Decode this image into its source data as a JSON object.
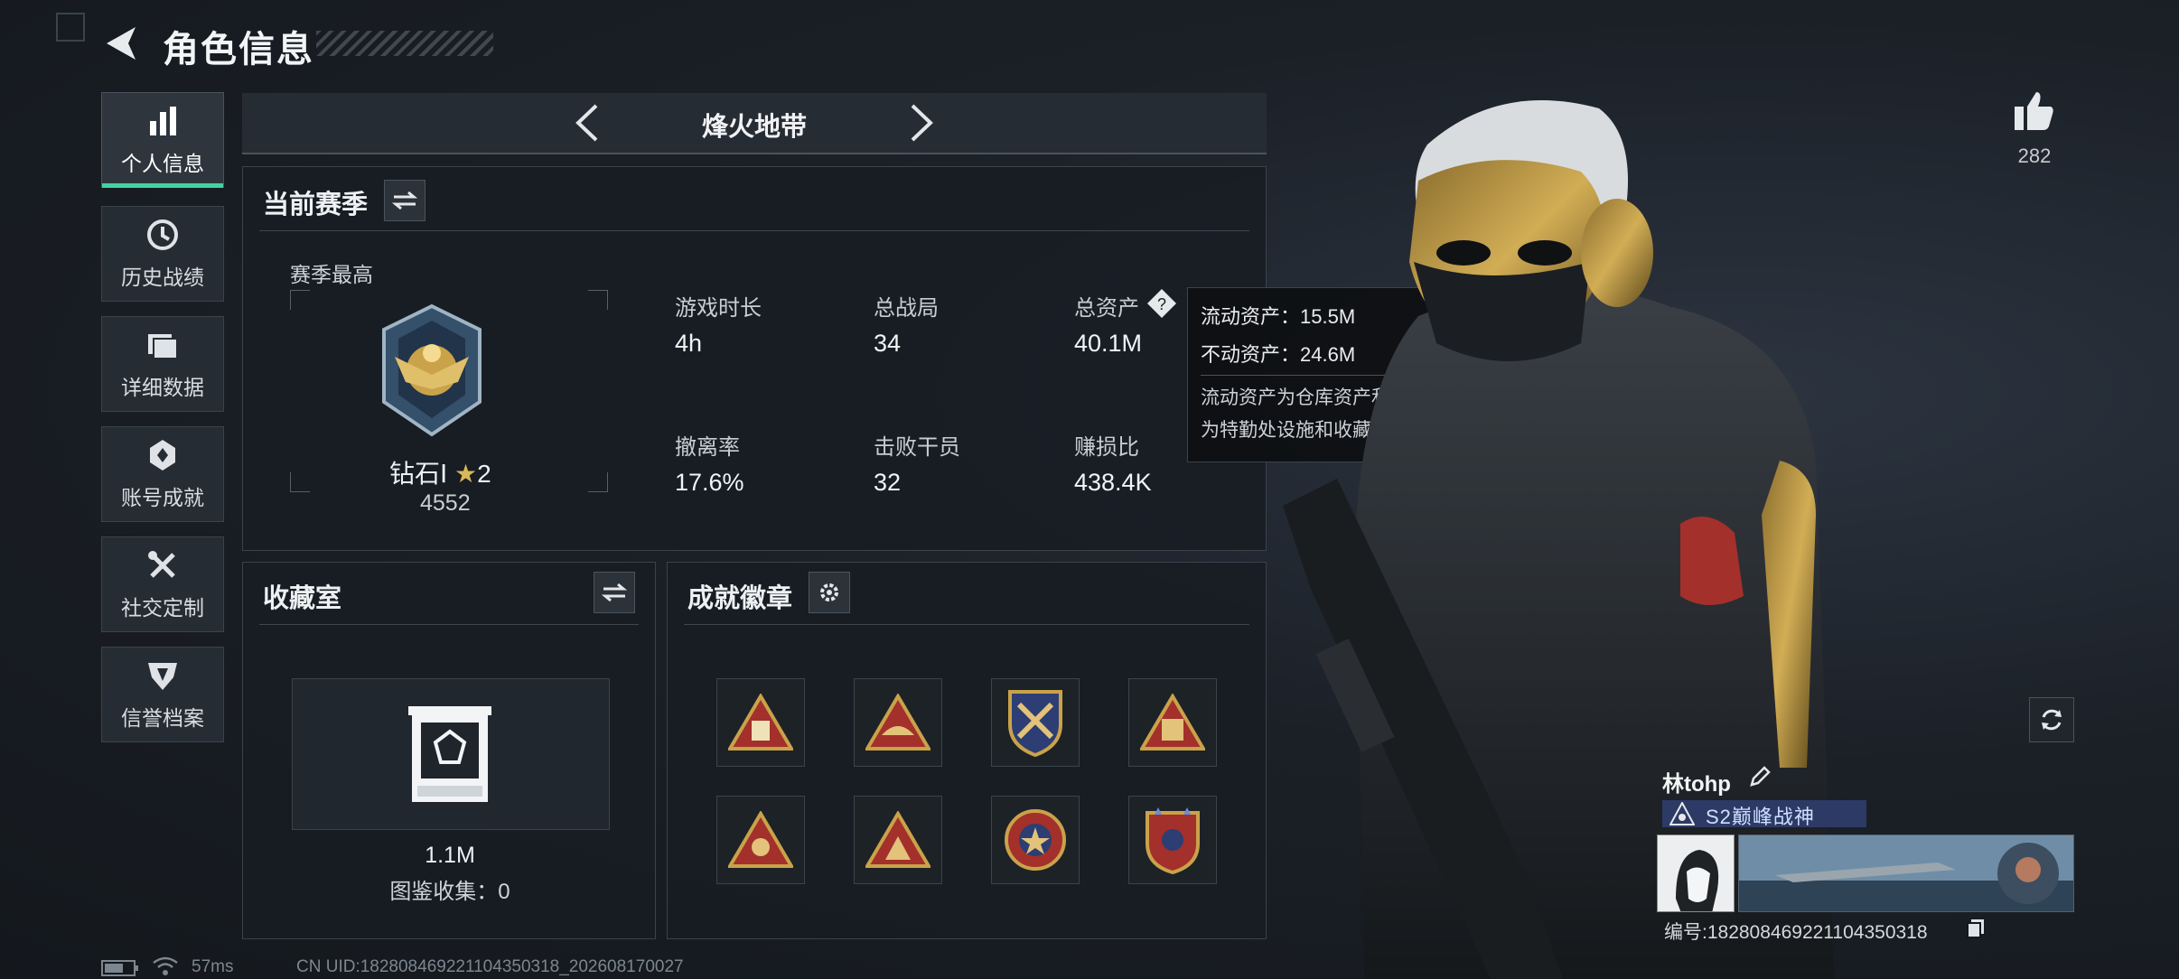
{
  "header": {
    "title": "角色信息",
    "back_icon": "back-arrow-icon"
  },
  "sidebar": {
    "items": [
      {
        "label": "个人信息",
        "icon": "bar-chart-icon",
        "active": true
      },
      {
        "label": "历史战绩",
        "icon": "history-clock-icon",
        "active": false
      },
      {
        "label": "详细数据",
        "icon": "folder-icon",
        "active": false
      },
      {
        "label": "账号成就",
        "icon": "achievement-icon",
        "active": false
      },
      {
        "label": "社交定制",
        "icon": "tools-icon",
        "active": false
      },
      {
        "label": "信誉档案",
        "icon": "reputation-icon",
        "active": false
      }
    ]
  },
  "mode_selector": {
    "label": "烽火地带"
  },
  "season": {
    "title": "当前赛季",
    "best_label": "赛季最高",
    "rank_name": "钻石Ⅰ",
    "rank_stars": "2",
    "rank_score": "4552",
    "stats": [
      {
        "label": "游戏时长",
        "value": "4h"
      },
      {
        "label": "总战局",
        "value": "34"
      },
      {
        "label": "总资产",
        "value": "40.1M"
      },
      {
        "label": "撤离率",
        "value": "17.6%"
      },
      {
        "label": "击败干员",
        "value": "32"
      },
      {
        "label": "赚损比",
        "value": "438.4K"
      }
    ]
  },
  "tooltip": {
    "liquid": "流动资产：15.5M",
    "fixed": "不动资产：24.6M",
    "desc1": "流动资产为仓库资产和哈夫币，不动资产",
    "desc2": "为特勤处设施和收藏室设施"
  },
  "collection": {
    "title": "收藏室",
    "value": "1.1M",
    "album": "图鉴收集：0"
  },
  "badges": {
    "title": "成就徽章",
    "items": [
      "triangle-badge-1",
      "triangle-badge-2",
      "shield-badge-3",
      "triangle-badge-4",
      "triangle-badge-5",
      "triangle-badge-6",
      "round-badge-7",
      "shield-badge-8"
    ]
  },
  "player": {
    "like_count": "282",
    "name": "林tohp",
    "title": "S2巅峰战神",
    "id_text": "编号:182808469221104350318"
  },
  "status_bar": {
    "ping": "57ms",
    "uid": "CN UID:182808469221104350318_202608170027"
  },
  "colors": {
    "accent": "#3fd4a2",
    "gold": "#c9a24a",
    "badge_red": "#a3302a"
  }
}
